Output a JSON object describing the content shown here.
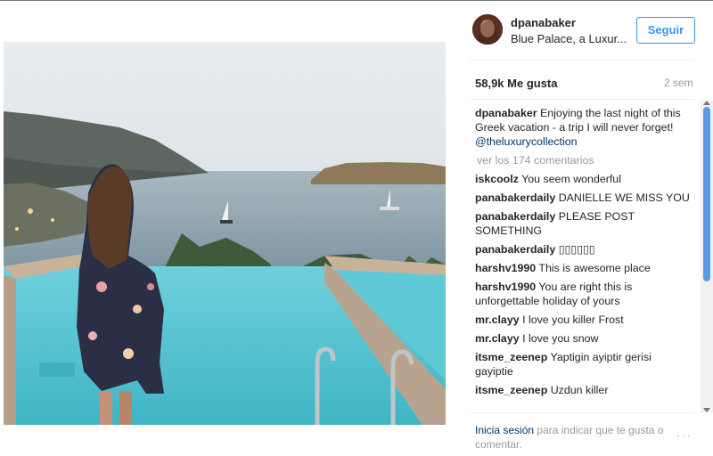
{
  "post": {
    "username": "dpanabaker",
    "location": "Blue Palace, a Luxur...",
    "follow_label": "Seguir",
    "likes": "58,9k Me gusta",
    "time": "2 sem",
    "caption": {
      "user": "dpanabaker",
      "text": "Enjoying the last night of this Greek vacation - a trip I will never forget!",
      "mention": "@theluxurycollection"
    },
    "view_all": "ver los 174 comentarios",
    "comments": [
      {
        "user": "iskcoolz",
        "text": "You seem wonderful"
      },
      {
        "user": "panabakerdaily",
        "text": "DANIELLE WE MISS YOU"
      },
      {
        "user": "panabakerdaily",
        "text": "PLEASE POST SOMETHING"
      },
      {
        "user": "panabakerdaily",
        "text": "▯▯▯▯▯▯"
      },
      {
        "user": "harshv1990",
        "text": "This is awesome place"
      },
      {
        "user": "harshv1990",
        "text": "You are right this is unforgettable holiday of yours"
      },
      {
        "user": "mr.clayy",
        "text": "I love you killer Frost"
      },
      {
        "user": "mr.clayy",
        "text": "I love you snow"
      },
      {
        "user": "itsme_zeenep",
        "text": "Yaptigin ayiptir gerisi gayiptie"
      },
      {
        "user": "itsme_zeenep",
        "text": "Uzdun killer"
      }
    ],
    "footer": {
      "login_label": "Inicia sesión",
      "rest": "para indicar que te gusta o comentar."
    },
    "more_label": "···"
  }
}
